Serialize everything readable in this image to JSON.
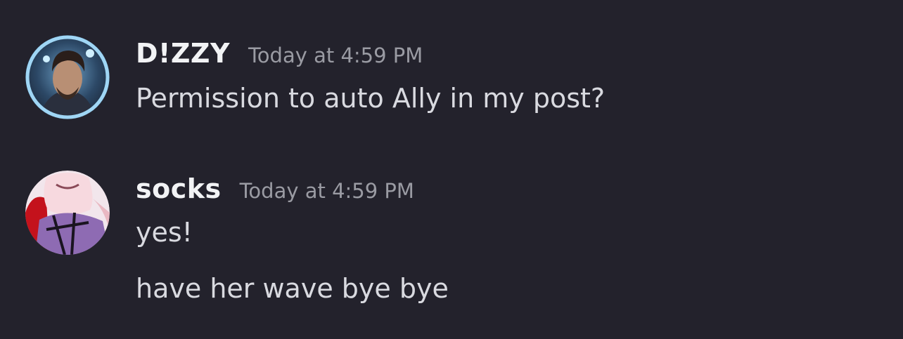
{
  "messages": [
    {
      "avatar_icon": "user-avatar-dark-haired-man",
      "username": "D!ZZY",
      "timestamp": "Today at 4:59 PM",
      "lines": [
        "Permission to auto Ally in my post?"
      ]
    },
    {
      "avatar_icon": "user-avatar-anime-character",
      "username": "socks",
      "timestamp": "Today at 4:59 PM",
      "lines": [
        "yes!",
        "have her wave bye bye"
      ]
    }
  ],
  "colors": {
    "background": "#23222c",
    "username": "#f2f3f5",
    "timestamp": "#9a9ba3",
    "message_text": "#d9dae0"
  }
}
